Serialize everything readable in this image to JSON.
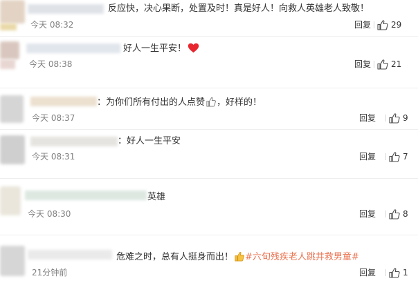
{
  "colors": {
    "text": "#333333",
    "muted": "#808080",
    "hashtag": "#eb7350",
    "heart": "#e8262f"
  },
  "comments": [
    {
      "text": "反应快，决心果断，处置及时！真是好人！向救人英雄老人致敬！",
      "time": "今天 08:32",
      "reply": "回复",
      "likes": "29",
      "like_icon": "thumb-up-icon"
    },
    {
      "text": "好人一生平安！",
      "emoji": "heart-icon",
      "time": "今天 08:38",
      "reply": "回复",
      "likes": "21",
      "like_icon": "thumb-up-icon"
    },
    {
      "text_a": "：为你们所有付出的人点赞",
      "emoji": "thumbs-up-emoji-icon",
      "text_b": "，好样的！",
      "time": "今天 08:37",
      "reply": "回复",
      "likes": "9",
      "like_icon": "thumb-up-icon"
    },
    {
      "text": "：好人一生平安",
      "time": "今天 08:31",
      "reply": "回复",
      "likes": "7",
      "like_icon": "thumb-up-icon"
    },
    {
      "text": "英雄",
      "time": "今天 08:30",
      "reply": "回复",
      "likes": "8",
      "like_icon": "thumb-up-icon"
    },
    {
      "text": "危难之时，总有人挺身而出！",
      "emoji": "thumbs-up-emoji-icon",
      "hashtag": "#六旬残疾老人跳井救男童#",
      "time": "21分钟前",
      "reply": "回复",
      "likes": "1",
      "like_icon": "thumb-up-icon"
    }
  ]
}
